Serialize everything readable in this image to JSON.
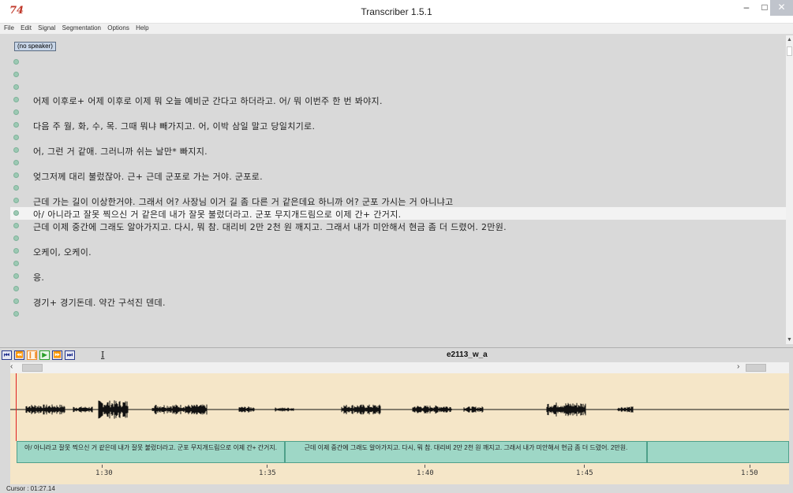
{
  "window": {
    "title": "Transcriber 1.5.1",
    "icon_text": "74",
    "minimize": "–",
    "maximize": "□",
    "close": "✕"
  },
  "menu": [
    "File",
    "Edit",
    "Signal",
    "Segmentation",
    "Options",
    "Help"
  ],
  "speaker_button": "(no speaker)",
  "transcript_lines": [
    "",
    "",
    "",
    "어제 이후로+ 어제 이후로 이제 뭐 오늘 예비군 간다고 하더라고. 어/ 뭐 이번주 한 번 봐야지.",
    "",
    "다음 주 월, 화, 수, 목. 그때 뭐냐 빼가지고. 어, 이박 삼일 말고 당일치기로.",
    "",
    "어, 그런 거 같애. 그러니까 쉬는 날만* 빠지지.",
    "",
    "엊그저께 대리 불렀잖아. 근+ 근데 군포로 가는 거야. 군포로.",
    "",
    "근데 가는 길이 이상한거야. 그래서 어? 사장님 이거 길 좀 다른 거 같은데요 하니까 어? 군포 가시는 거 아니냐고",
    "아/ 아니라고 잘못 찍으신 거 같은데 내가 잘못 불렀더라고. 군포 무지개드림으로 이제 간+ 간거지.",
    "근데 이제 중간에 그래도 알아가지고. 다시, 뭐 참. 대리비 2만 2천 원 깨지고. 그래서 내가 미안해서 현금 좀 더 드렸어. 2만원.",
    "",
    "오케이, 오케이.",
    "",
    "응.",
    "",
    "경기+ 경기돈데. 약간 구석진 덴데.",
    ""
  ],
  "highlighted_line": 12,
  "transport": {
    "buttons": [
      "⏮",
      "⏪",
      "❙❙",
      "▶",
      "⏩",
      "⏭"
    ],
    "ibeam": "I",
    "filename": "e2113_w_a"
  },
  "segments": [
    "아/ 아니라고 잘못 찍으신 거 같은데 내가 잘못 불렀더라고. 군포 무지개드림으로 이제 간+ 간거지.",
    "근데 이제 중간에 그래도 알아가지고. 다시, 뭐 참. 대리비 2만 2천 원 깨지고. 그래서 내가 미안해서 현금 좀 더 드렸어. 2만원.",
    ""
  ],
  "time_axis": [
    "1:30",
    "1:35",
    "1:40",
    "1:45",
    "1:50"
  ],
  "status": "Cursor : 01:27.14",
  "colors": {
    "waveform_bg": "#f5e6c8",
    "segment": "#9ed7c6",
    "cursor": "#e02020",
    "play": "#2aa02a",
    "pause": "#f08c28"
  }
}
